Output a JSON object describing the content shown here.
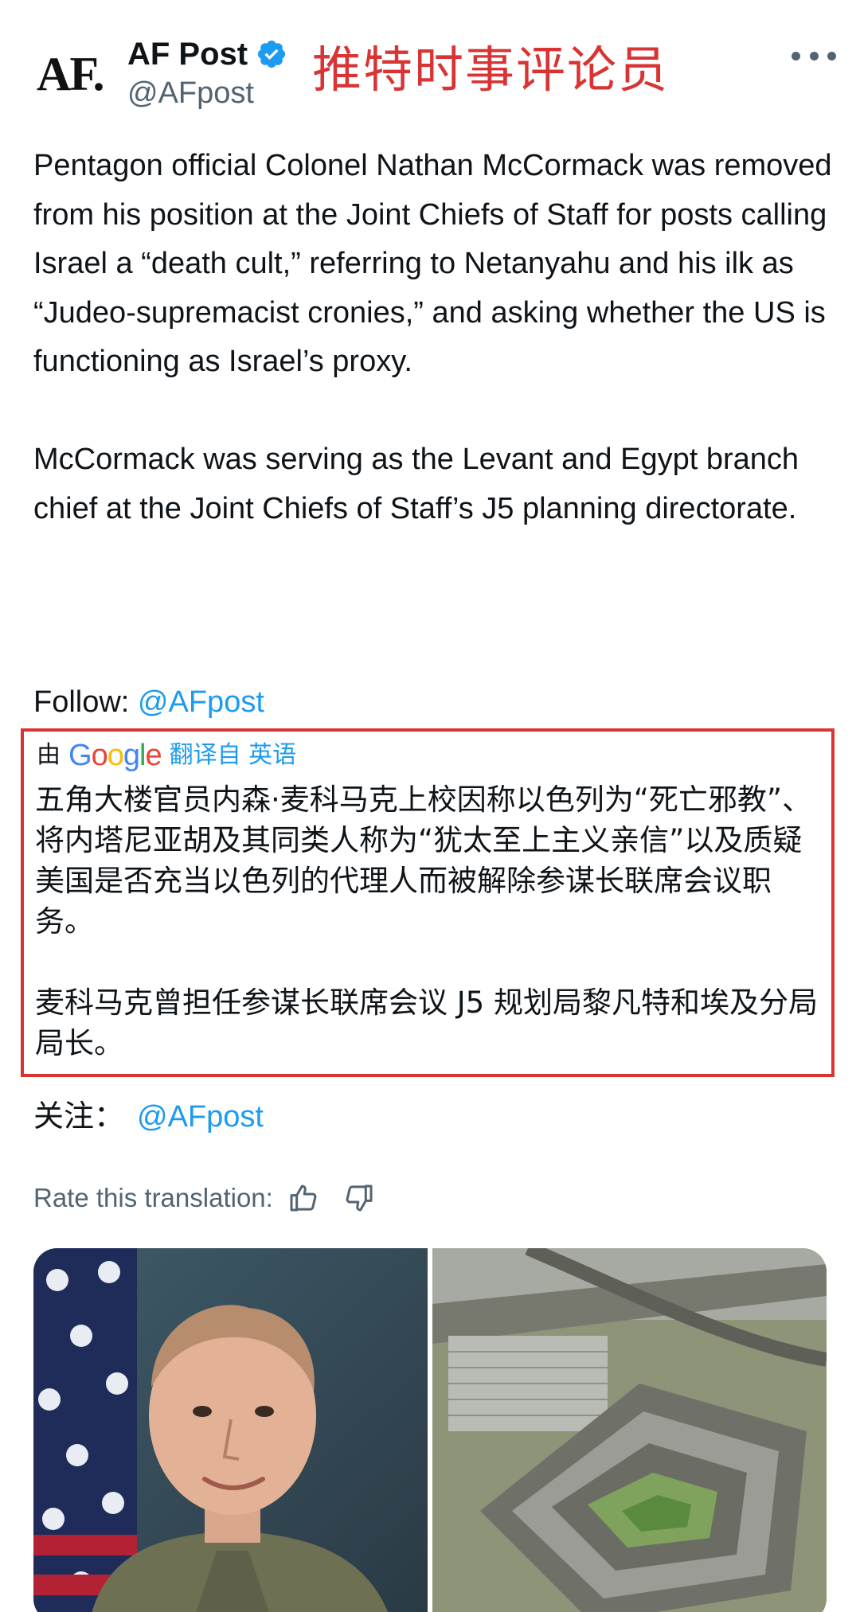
{
  "author": {
    "logo_text": "AF.",
    "display_name": "AF Post",
    "handle": "@AFpost",
    "verified": true
  },
  "watermark": "推特时事评论员",
  "tweet": {
    "paragraphs": [
      "Pentagon official Colonel Nathan McCormack was removed from his position at the Joint Chiefs of Staff for posts calling Israel a “death cult,” referring to Netanyahu and his ilk as “Judeo-supremacist cronies,” and asking whether the US is functioning as Israel’s proxy.",
      "McCormack was serving as the Levant and Egypt branch chief at the Joint Chiefs of Staff’s J5 planning directorate."
    ],
    "follow_label": "Follow: ",
    "follow_mention": "@AFpost"
  },
  "translation": {
    "by_label": "由",
    "provider": "Google",
    "from_label": "翻译自 英语",
    "paragraphs": [
      "五角大楼官员内森·麦科马克上校因称以色列为“死亡邪教”、将内塔尼亚胡及其同类人称为“犹太至上主义亲信”以及质疑美国是否充当以色列的代理人而被解除参谋长联席会议职务。",
      "麦科马克曾担任参谋长联席会议 J5 规划局黎凡特和埃及分局局长。"
    ],
    "follow_label": "关注：",
    "follow_mention": "@AFpost",
    "highlight_color": "#d83434"
  },
  "rate": {
    "label": "Rate this translation:"
  },
  "media": {
    "images": [
      "portrait-photo",
      "pentagon-aerial-photo"
    ]
  },
  "colors": {
    "link": "#1d9bf0",
    "secondary_text": "#536471",
    "verified": "#1d9bf0",
    "watermark": "#d83434"
  }
}
